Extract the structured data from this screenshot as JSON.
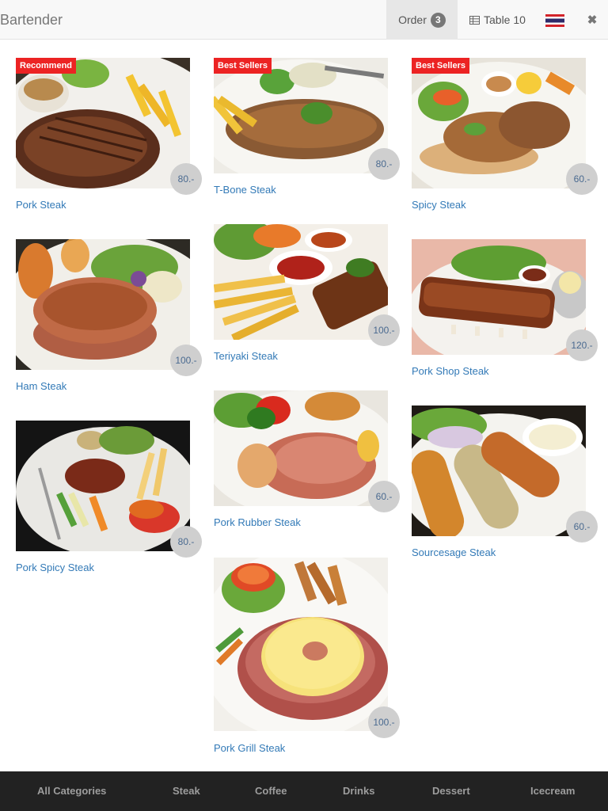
{
  "header": {
    "brand": "Bartender",
    "order_label": "Order",
    "order_count": "3",
    "table_label": "Table 10",
    "table_icon": "table-icon",
    "flag_icon": "thai-flag-icon",
    "close_icon": "close-icon"
  },
  "menu": {
    "items": [
      {
        "name": "Pork Steak",
        "price": "80.-",
        "tag": "Recommend"
      },
      {
        "name": "T-Bone Steak",
        "price": "80.-",
        "tag": "Best Sellers"
      },
      {
        "name": "Spicy Steak",
        "price": "60.-",
        "tag": "Best Sellers"
      },
      {
        "name": "Ham Steak",
        "price": "100.-",
        "tag": ""
      },
      {
        "name": "Teriyaki Steak",
        "price": "100.-",
        "tag": ""
      },
      {
        "name": "Pork Shop Steak",
        "price": "120.-",
        "tag": ""
      },
      {
        "name": "Pork Spicy Steak",
        "price": "80.-",
        "tag": ""
      },
      {
        "name": "Pork Rubber Steak",
        "price": "60.-",
        "tag": ""
      },
      {
        "name": "Sourcesage Steak",
        "price": "60.-",
        "tag": ""
      },
      {
        "name": "Pork Grill Steak",
        "price": "100.-",
        "tag": ""
      }
    ]
  },
  "categories": [
    "All Categories",
    "Steak",
    "Coffee",
    "Drinks",
    "Dessert",
    "Icecream"
  ],
  "colors": {
    "tag_red": "#ec2323",
    "link_blue": "#337ab7",
    "footer_bg": "#222222"
  }
}
